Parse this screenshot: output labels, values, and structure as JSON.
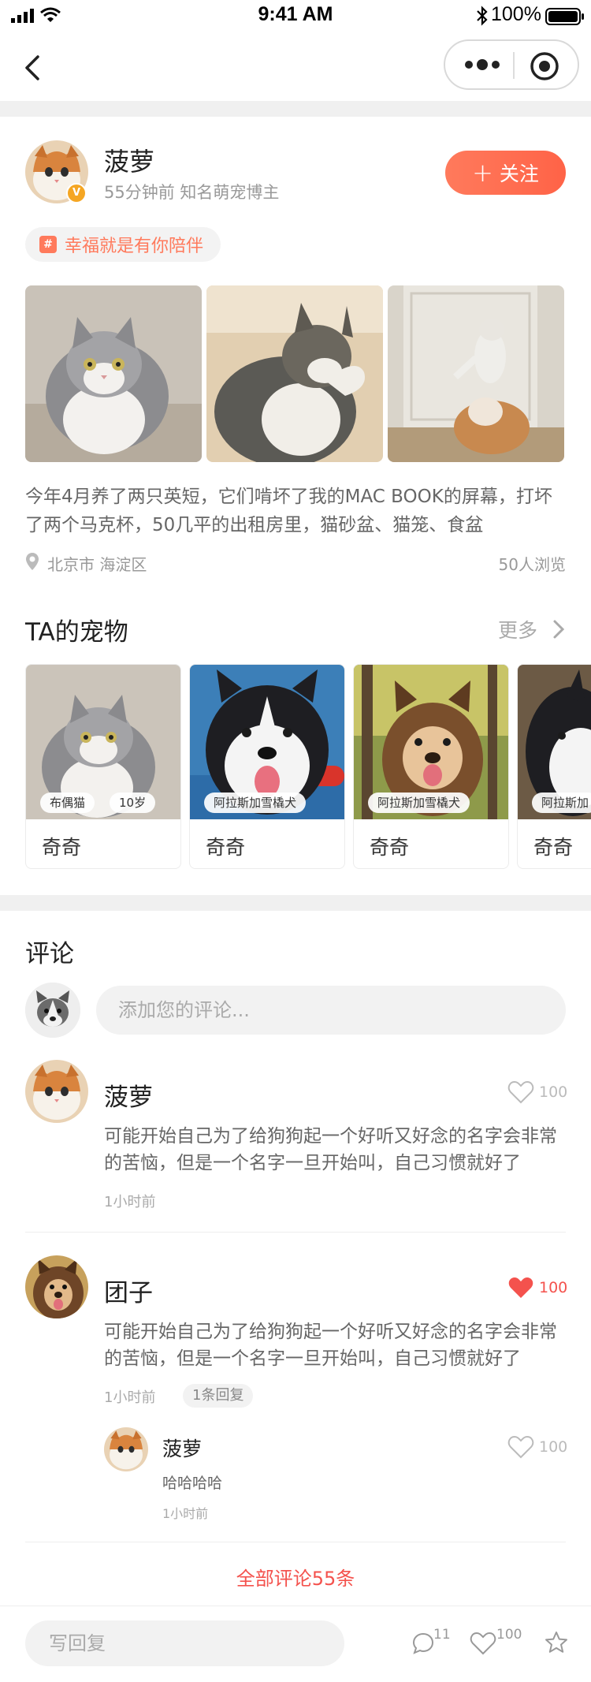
{
  "status_bar": {
    "time": "9:41 AM",
    "battery": "100%"
  },
  "post": {
    "author_name": "菠萝",
    "author_meta": "55分钟前  知名萌宠博主",
    "verified_badge": "V",
    "follow_label": "关注",
    "topic_symbol": "#",
    "topic": "幸福就是有你陪伴",
    "text": "今年4月养了两只英短，它们啃坏了我的MAC BOOK的屏幕，打坏了两个马克杯，50几平的出租房里，猫砂盆、猫笼、食盆",
    "location": "北京市 海淀区",
    "views": "50人浏览"
  },
  "pets": {
    "title": "TA的宠物",
    "more_label": "更多",
    "items": [
      {
        "name": "奇奇",
        "tags": [
          "布偶猫",
          "10岁"
        ]
      },
      {
        "name": "奇奇",
        "tags": [
          "阿拉斯加雪橇犬"
        ]
      },
      {
        "name": "奇奇",
        "tags": [
          "阿拉斯加雪橇犬"
        ]
      },
      {
        "name": "奇奇",
        "tags": [
          "阿拉斯加"
        ]
      }
    ]
  },
  "comments": {
    "title": "评论",
    "input_placeholder": "添加您的评论...",
    "items": [
      {
        "name": "菠萝",
        "likes": "100",
        "liked": false,
        "text": "可能开始自己为了给狗狗起一个好听又好念的名字会非常的苦恼，但是一个名字一旦开始叫，自己习惯就好了",
        "time": "1小时前"
      },
      {
        "name": "团子",
        "likes": "100",
        "liked": true,
        "text": "可能开始自己为了给狗狗起一个好听又好念的名字会非常的苦恼，但是一个名字一旦开始叫，自己习惯就好了",
        "time": "1小时前",
        "reply_count_label": "1条回复",
        "reply": {
          "name": "菠萝",
          "text": "哈哈哈哈",
          "time": "1小时前",
          "likes": "100"
        }
      }
    ],
    "all_label": "全部评论55条"
  },
  "bottom_bar": {
    "reply_placeholder": "写回复",
    "comment_count": "11",
    "like_count": "100"
  },
  "colors": {
    "accent": "#ff6b4d",
    "like_red": "#f4524d",
    "band": "#f0f0f0"
  },
  "icons": [
    "signal-icon",
    "wifi-icon",
    "bluetooth-icon",
    "battery-icon",
    "back-arrow-icon",
    "more-dots-icon",
    "target-icon",
    "plus-icon",
    "hashtag-icon",
    "location-pin-icon",
    "chevron-right-icon",
    "heart-outline-icon",
    "heart-filled-icon",
    "comment-bubble-icon",
    "star-icon"
  ]
}
